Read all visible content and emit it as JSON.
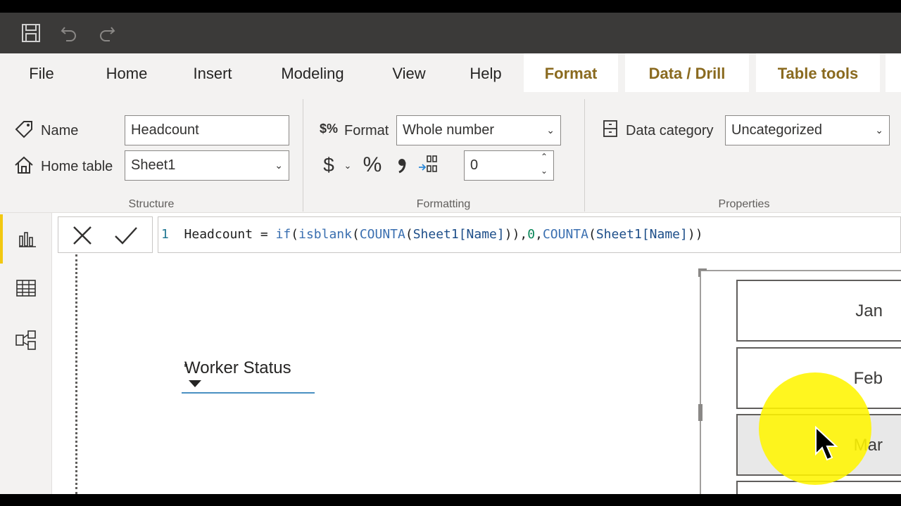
{
  "ribbon": {
    "tabs": [
      {
        "label": "File"
      },
      {
        "label": "Home"
      },
      {
        "label": "Insert"
      },
      {
        "label": "Modeling"
      },
      {
        "label": "View"
      },
      {
        "label": "Help"
      },
      {
        "label": "Format"
      },
      {
        "label": "Data / Drill"
      },
      {
        "label": "Table tools"
      }
    ],
    "structure": {
      "name_label": "Name",
      "name_value": "Headcount",
      "home_table_label": "Home table",
      "home_table_value": "Sheet1",
      "group_label": "Structure"
    },
    "formatting": {
      "format_label": "Format",
      "format_value": "Whole number",
      "currency_symbol": "$",
      "percent_symbol": "%",
      "comma_symbol": "\u0019",
      "decimals_value": "0",
      "group_label": "Formatting"
    },
    "properties": {
      "data_category_label": "Data category",
      "data_category_value": "Uncategorized",
      "group_label": "Properties"
    }
  },
  "formula": {
    "line_number": "1",
    "parts": [
      {
        "t": "plain",
        "v": "Headcount = "
      },
      {
        "t": "func",
        "v": "if"
      },
      {
        "t": "plain",
        "v": "("
      },
      {
        "t": "func",
        "v": "isblank"
      },
      {
        "t": "plain",
        "v": "("
      },
      {
        "t": "func",
        "v": "COUNTA"
      },
      {
        "t": "plain",
        "v": "("
      },
      {
        "t": "col",
        "v": "Sheet1[Name]"
      },
      {
        "t": "plain",
        "v": ")),"
      },
      {
        "t": "num",
        "v": "0"
      },
      {
        "t": "plain",
        "v": ","
      },
      {
        "t": "func",
        "v": "COUNTA"
      },
      {
        "t": "plain",
        "v": "("
      },
      {
        "t": "col",
        "v": "Sheet1[Name]"
      },
      {
        "t": "plain",
        "v": "))"
      }
    ]
  },
  "canvas": {
    "slicer_title": "Worker Status",
    "months": [
      "Jan",
      "Feb",
      "Mar"
    ],
    "selected_month": "Mar"
  },
  "colors": {
    "accent": "#f2c811",
    "context_tab_text": "#8a6a1f",
    "highlight": "#fff500"
  }
}
